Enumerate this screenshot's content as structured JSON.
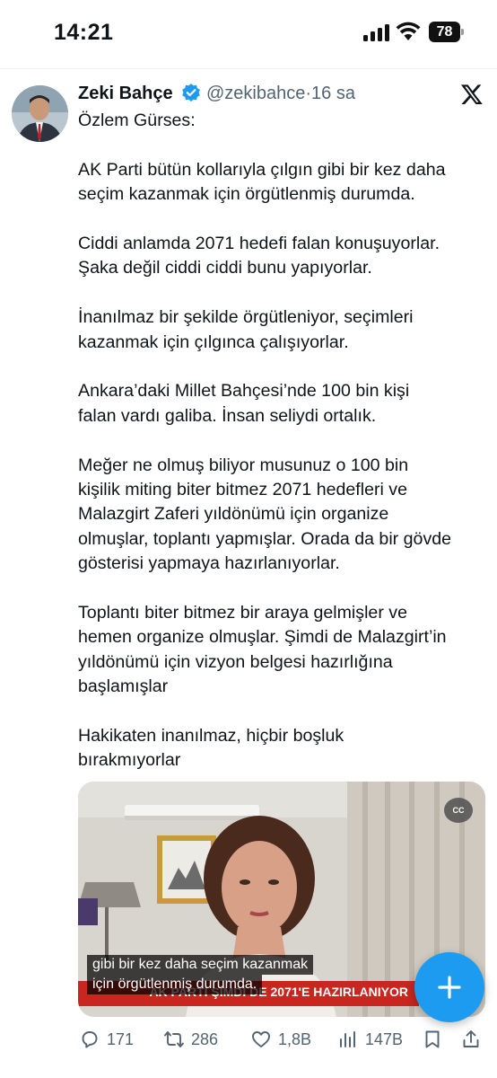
{
  "status_bar": {
    "time": "14:21",
    "battery": "78",
    "icons": [
      "signal-icon",
      "wifi-icon",
      "battery-icon"
    ]
  },
  "tweet": {
    "author_name": "Zeki Bahçe",
    "verified": true,
    "handle": "@zekibahce",
    "separator": "·",
    "time_ago": "16 sa",
    "paragraphs": [
      [
        "Özlem Gürses:"
      ],
      [
        "AK Parti bütün kollarıyla çılgın gibi bir kez daha",
        "seçim kazanmak için örgütlenmiş durumda."
      ],
      [
        "Ciddi anlamda 2071 hedefi falan konuşuyorlar.",
        "Şaka değil ciddi ciddi bunu yapıyorlar."
      ],
      [
        "İnanılmaz bir şekilde örgütleniyor, seçimleri",
        "kazanmak için çılgınca çalışıyorlar."
      ],
      [
        "Ankara’daki Millet Bahçesi’nde 100 bin kişi",
        "falan vardı galiba. İnsan seliydi ortalık."
      ],
      [
        "Meğer ne olmuş biliyor musunuz o 100 bin",
        "kişilik miting biter bitmez 2071 hedefleri ve",
        "Malazgirt Zaferi yıldönümü için organize",
        "olmuşlar, toplantı yapmışlar. Orada da bir gövde",
        "gösterisi yapmaya hazırlanıyorlar."
      ],
      [
        "Toplantı biter bitmez bir araya gelmişler ve",
        "hemen organize olmuşlar. Şimdi de Malazgirt’in",
        "yıldönümü için vizyon belgesi hazırlığına",
        "başlamışlar"
      ],
      [
        "Hakikaten inanılmaz, hiçbir boşluk",
        "bırakmıyorlar"
      ]
    ],
    "video": {
      "cc_label": "CC",
      "banner_text": "AK PARTİ ŞİMDİ DE 2071'E HAZIRLANIYOR",
      "captions": [
        "gibi bir kez daha seçim kazanmak",
        "için örgütlenmiş durumda."
      ]
    },
    "actions": {
      "replies": "171",
      "reposts": "286",
      "likes": "1,8B",
      "views": "147B"
    }
  },
  "colors": {
    "accent": "#1d9bf0",
    "muted": "#536471",
    "text": "#0f1419"
  }
}
